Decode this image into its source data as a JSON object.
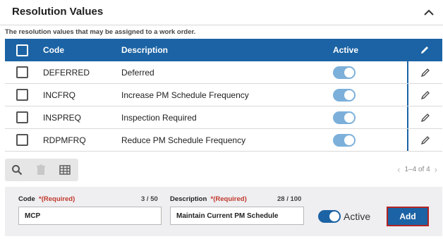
{
  "panel": {
    "title": "Resolution Values",
    "description": "The resolution values that may be assigned to a work order."
  },
  "table": {
    "headers": {
      "code": "Code",
      "description": "Description",
      "active": "Active"
    },
    "rows": [
      {
        "code": "DEFERRED",
        "description": "Deferred",
        "active": true
      },
      {
        "code": "INCFRQ",
        "description": "Increase PM Schedule Frequency",
        "active": true
      },
      {
        "code": "INSPREQ",
        "description": "Inspection Required",
        "active": true
      },
      {
        "code": "RDPMFRQ",
        "description": "Reduce PM Schedule Frequency",
        "active": true
      }
    ]
  },
  "toolbar": {
    "icons": [
      "search-icon",
      "trash-icon",
      "grid-icon"
    ]
  },
  "pager": {
    "prev": "‹",
    "text": "1–4 of 4",
    "next": "›"
  },
  "form": {
    "code_label": "Code",
    "code_required": "*(Required)",
    "code_count": "3 / 50",
    "code_value": "MCP",
    "desc_label": "Description",
    "desc_required": "*(Required)",
    "desc_count": "28 / 100",
    "desc_value": "Maintain Current PM Schedule",
    "active_label": "Active",
    "active": true,
    "add_label": "Add"
  },
  "colors": {
    "header_blue": "#1b63a4",
    "toggle_light": "#7cb0da",
    "required_red": "#c0392b",
    "add_border": "#b32424"
  }
}
